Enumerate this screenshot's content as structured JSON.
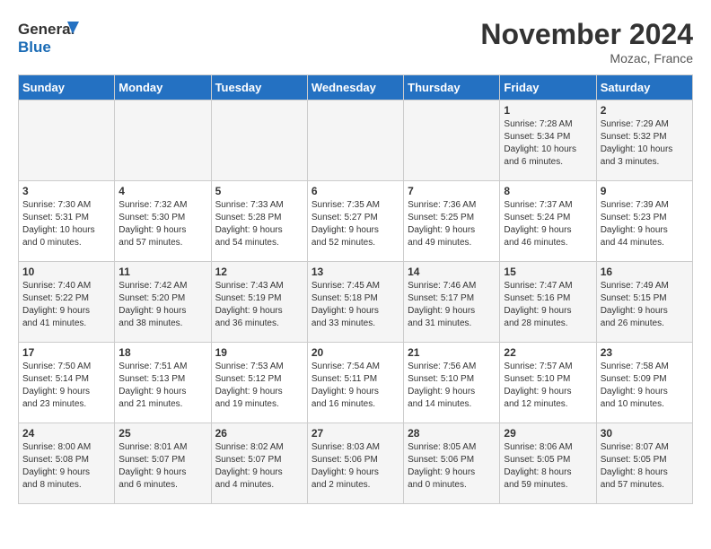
{
  "header": {
    "logo_general": "General",
    "logo_blue": "Blue",
    "month_title": "November 2024",
    "location": "Mozac, France"
  },
  "weekdays": [
    "Sunday",
    "Monday",
    "Tuesday",
    "Wednesday",
    "Thursday",
    "Friday",
    "Saturday"
  ],
  "weeks": [
    [
      {
        "day": "",
        "info": ""
      },
      {
        "day": "",
        "info": ""
      },
      {
        "day": "",
        "info": ""
      },
      {
        "day": "",
        "info": ""
      },
      {
        "day": "",
        "info": ""
      },
      {
        "day": "1",
        "info": "Sunrise: 7:28 AM\nSunset: 5:34 PM\nDaylight: 10 hours\nand 6 minutes."
      },
      {
        "day": "2",
        "info": "Sunrise: 7:29 AM\nSunset: 5:32 PM\nDaylight: 10 hours\nand 3 minutes."
      }
    ],
    [
      {
        "day": "3",
        "info": "Sunrise: 7:30 AM\nSunset: 5:31 PM\nDaylight: 10 hours\nand 0 minutes."
      },
      {
        "day": "4",
        "info": "Sunrise: 7:32 AM\nSunset: 5:30 PM\nDaylight: 9 hours\nand 57 minutes."
      },
      {
        "day": "5",
        "info": "Sunrise: 7:33 AM\nSunset: 5:28 PM\nDaylight: 9 hours\nand 54 minutes."
      },
      {
        "day": "6",
        "info": "Sunrise: 7:35 AM\nSunset: 5:27 PM\nDaylight: 9 hours\nand 52 minutes."
      },
      {
        "day": "7",
        "info": "Sunrise: 7:36 AM\nSunset: 5:25 PM\nDaylight: 9 hours\nand 49 minutes."
      },
      {
        "day": "8",
        "info": "Sunrise: 7:37 AM\nSunset: 5:24 PM\nDaylight: 9 hours\nand 46 minutes."
      },
      {
        "day": "9",
        "info": "Sunrise: 7:39 AM\nSunset: 5:23 PM\nDaylight: 9 hours\nand 44 minutes."
      }
    ],
    [
      {
        "day": "10",
        "info": "Sunrise: 7:40 AM\nSunset: 5:22 PM\nDaylight: 9 hours\nand 41 minutes."
      },
      {
        "day": "11",
        "info": "Sunrise: 7:42 AM\nSunset: 5:20 PM\nDaylight: 9 hours\nand 38 minutes."
      },
      {
        "day": "12",
        "info": "Sunrise: 7:43 AM\nSunset: 5:19 PM\nDaylight: 9 hours\nand 36 minutes."
      },
      {
        "day": "13",
        "info": "Sunrise: 7:45 AM\nSunset: 5:18 PM\nDaylight: 9 hours\nand 33 minutes."
      },
      {
        "day": "14",
        "info": "Sunrise: 7:46 AM\nSunset: 5:17 PM\nDaylight: 9 hours\nand 31 minutes."
      },
      {
        "day": "15",
        "info": "Sunrise: 7:47 AM\nSunset: 5:16 PM\nDaylight: 9 hours\nand 28 minutes."
      },
      {
        "day": "16",
        "info": "Sunrise: 7:49 AM\nSunset: 5:15 PM\nDaylight: 9 hours\nand 26 minutes."
      }
    ],
    [
      {
        "day": "17",
        "info": "Sunrise: 7:50 AM\nSunset: 5:14 PM\nDaylight: 9 hours\nand 23 minutes."
      },
      {
        "day": "18",
        "info": "Sunrise: 7:51 AM\nSunset: 5:13 PM\nDaylight: 9 hours\nand 21 minutes."
      },
      {
        "day": "19",
        "info": "Sunrise: 7:53 AM\nSunset: 5:12 PM\nDaylight: 9 hours\nand 19 minutes."
      },
      {
        "day": "20",
        "info": "Sunrise: 7:54 AM\nSunset: 5:11 PM\nDaylight: 9 hours\nand 16 minutes."
      },
      {
        "day": "21",
        "info": "Sunrise: 7:56 AM\nSunset: 5:10 PM\nDaylight: 9 hours\nand 14 minutes."
      },
      {
        "day": "22",
        "info": "Sunrise: 7:57 AM\nSunset: 5:10 PM\nDaylight: 9 hours\nand 12 minutes."
      },
      {
        "day": "23",
        "info": "Sunrise: 7:58 AM\nSunset: 5:09 PM\nDaylight: 9 hours\nand 10 minutes."
      }
    ],
    [
      {
        "day": "24",
        "info": "Sunrise: 8:00 AM\nSunset: 5:08 PM\nDaylight: 9 hours\nand 8 minutes."
      },
      {
        "day": "25",
        "info": "Sunrise: 8:01 AM\nSunset: 5:07 PM\nDaylight: 9 hours\nand 6 minutes."
      },
      {
        "day": "26",
        "info": "Sunrise: 8:02 AM\nSunset: 5:07 PM\nDaylight: 9 hours\nand 4 minutes."
      },
      {
        "day": "27",
        "info": "Sunrise: 8:03 AM\nSunset: 5:06 PM\nDaylight: 9 hours\nand 2 minutes."
      },
      {
        "day": "28",
        "info": "Sunrise: 8:05 AM\nSunset: 5:06 PM\nDaylight: 9 hours\nand 0 minutes."
      },
      {
        "day": "29",
        "info": "Sunrise: 8:06 AM\nSunset: 5:05 PM\nDaylight: 8 hours\nand 59 minutes."
      },
      {
        "day": "30",
        "info": "Sunrise: 8:07 AM\nSunset: 5:05 PM\nDaylight: 8 hours\nand 57 minutes."
      }
    ]
  ]
}
